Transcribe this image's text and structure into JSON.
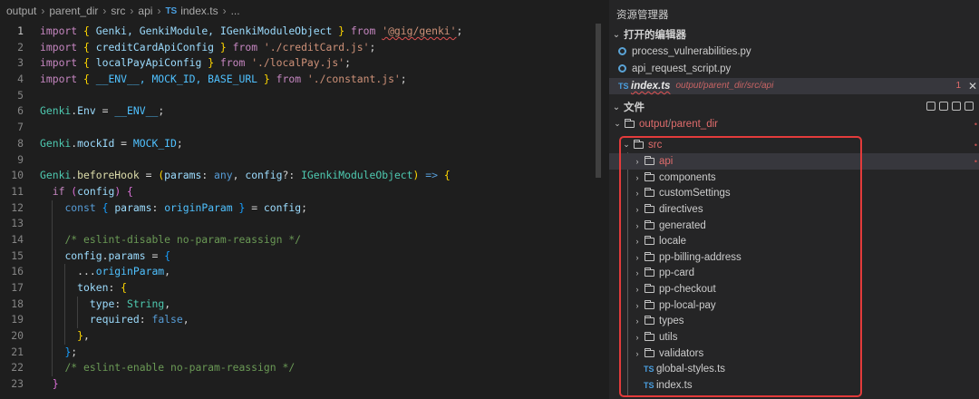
{
  "breadcrumb": {
    "items": [
      "output",
      "parent_dir",
      "src",
      "api"
    ],
    "file_badge": "TS",
    "file": "index.ts",
    "trail": "..."
  },
  "editor": {
    "active_line": 1,
    "lines": [
      {
        "n": "1"
      },
      {
        "n": "2"
      },
      {
        "n": "3"
      },
      {
        "n": "4"
      },
      {
        "n": "5"
      },
      {
        "n": "6"
      },
      {
        "n": "7"
      },
      {
        "n": "8"
      },
      {
        "n": "9"
      },
      {
        "n": "10"
      },
      {
        "n": "11"
      },
      {
        "n": "12"
      },
      {
        "n": "13"
      },
      {
        "n": "14"
      },
      {
        "n": "15"
      },
      {
        "n": "16"
      },
      {
        "n": "17"
      },
      {
        "n": "18"
      },
      {
        "n": "19"
      },
      {
        "n": "20"
      },
      {
        "n": "21"
      },
      {
        "n": "22"
      },
      {
        "n": "23"
      }
    ],
    "code": {
      "l1_import": "import",
      "l1_names": "Genki, GenkiModule, IGenkiModuleObject",
      "l1_from": "from",
      "l1_mod": "'@gig/genki'",
      "l2_import": "import",
      "l2_names": "creditCardApiConfig",
      "l2_from": "from",
      "l2_mod": "'./creditCard.js'",
      "l3_import": "import",
      "l3_names": "localPayApiConfig",
      "l3_from": "from",
      "l3_mod": "'./localPay.js'",
      "l4_import": "import",
      "l4_names": "__ENV__, MOCK_ID, BASE_URL",
      "l4_from": "from",
      "l4_mod": "'./constant.js'",
      "l6_obj": "Genki",
      "l6_prop": "Env",
      "l6_val": "__ENV__",
      "l8_obj": "Genki",
      "l8_prop": "mockId",
      "l8_val": "MOCK_ID",
      "l10_obj": "Genki",
      "l10_prop": "beforeHook",
      "l10_p1": "params",
      "l10_t1": "any",
      "l10_p2": "config",
      "l10_t2": "IGenkiModuleObject",
      "l11_if": "if",
      "l11_var": "config",
      "l12_const": "const",
      "l12_key": "params",
      "l12_alias": "originParam",
      "l12_val": "config",
      "l14_comment": "/* eslint-disable no-param-reassign */",
      "l15_obj": "config",
      "l15_prop": "params",
      "l16_spread": "originParam",
      "l17_key": "token",
      "l18_key": "type",
      "l18_val": "String",
      "l19_key": "required",
      "l19_val": "false",
      "l22_comment": "/* eslint-enable no-param-reassign */"
    }
  },
  "sidebar": {
    "title": "资源管理器",
    "open_editors_header": "打开的编辑器",
    "open_editors": [
      {
        "name": "process_vulnerabilities.py",
        "icon": "python-file-icon"
      },
      {
        "name": "api_request_script.py",
        "icon": "python-file-icon"
      },
      {
        "name": "index.ts",
        "badge": "TS",
        "path": "output/parent_dir/src/api",
        "problems": "1",
        "close": "✕"
      }
    ],
    "files_header": "文件",
    "root": {
      "a": "output",
      "slash": "/",
      "b": "parent_dir"
    },
    "src": "src",
    "folders": [
      "api",
      "components",
      "customSettings",
      "directives",
      "generated",
      "locale",
      "pp-billing-address",
      "pp-card",
      "pp-checkout",
      "pp-local-pay",
      "types",
      "utils",
      "validators"
    ],
    "files": [
      {
        "badge": "TS",
        "name": "global-styles.ts"
      },
      {
        "badge": "TS",
        "name": "index.ts"
      }
    ],
    "error_dot": "•"
  },
  "colors": {
    "accent": "#e33b3b",
    "ts": "#4a9fe0",
    "error": "#e06c6c"
  }
}
